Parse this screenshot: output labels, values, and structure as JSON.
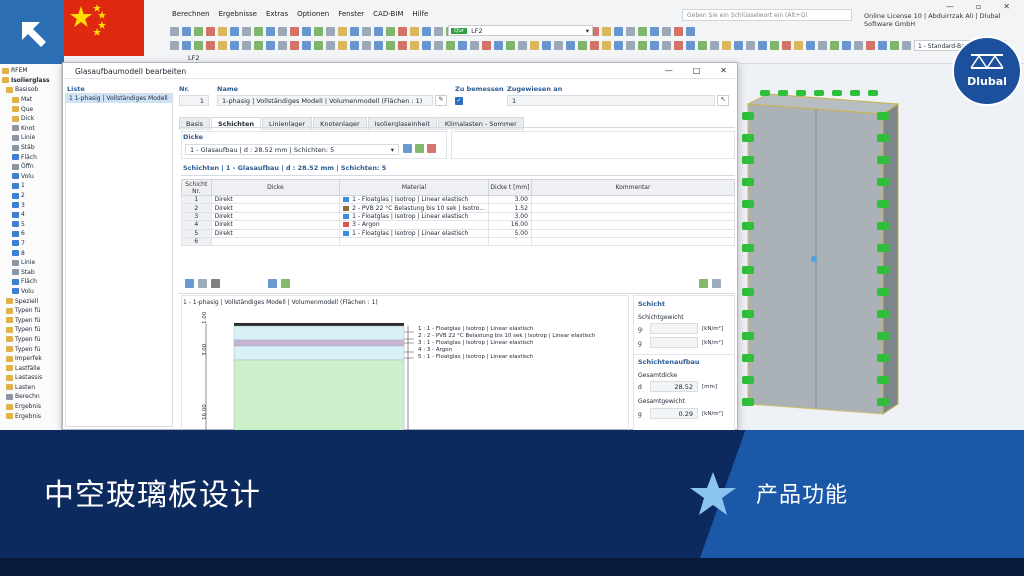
{
  "menu": {
    "items": [
      "Berechnen",
      "Ergebnisse",
      "Extras",
      "Optionen",
      "Fenster",
      "CAD-BIM",
      "Hilfe"
    ]
  },
  "search": {
    "placeholder": "Geben Sie ein Schlüsselwort ein (Alt+Q)"
  },
  "license": "Online License 10 | Abduirrzak Ali | Dlubal Software GmbH",
  "toolbar": {
    "lf_badge": "Qur",
    "lf_value": "LF2",
    "lf_label": "LF2",
    "basislayer": "1 - Standard-Basislayer"
  },
  "tree": {
    "items": [
      {
        "label": "RFEM",
        "icon": "folder"
      },
      {
        "label": "Isolierglass",
        "icon": "folder",
        "bold": true
      },
      {
        "label": "Basisob",
        "icon": "folder"
      },
      {
        "label": "Mat",
        "icon": "folder"
      },
      {
        "label": "Que",
        "icon": "folder"
      },
      {
        "label": "Dick",
        "icon": "folder"
      },
      {
        "label": "Knot",
        "icon": "grey"
      },
      {
        "label": "Linie",
        "icon": "grey"
      },
      {
        "label": "Stäb",
        "icon": "grey"
      },
      {
        "label": "Fläch",
        "icon": "blue"
      },
      {
        "label": "Öffn",
        "icon": "grey"
      },
      {
        "label": "Volu",
        "icon": "blue"
      },
      {
        "label": "1",
        "icon": "blue"
      },
      {
        "label": "2",
        "icon": "blue"
      },
      {
        "label": "3",
        "icon": "blue"
      },
      {
        "label": "4",
        "icon": "blue"
      },
      {
        "label": "5",
        "icon": "blue"
      },
      {
        "label": "6",
        "icon": "blue"
      },
      {
        "label": "7",
        "icon": "blue"
      },
      {
        "label": "8",
        "icon": "blue"
      },
      {
        "label": "Linie",
        "icon": "grey"
      },
      {
        "label": "Stab",
        "icon": "grey"
      },
      {
        "label": "Fläch",
        "icon": "blue"
      },
      {
        "label": "Volu",
        "icon": "blue"
      },
      {
        "label": "Speziell",
        "icon": "folder"
      },
      {
        "label": "Typen fü",
        "icon": "folder"
      },
      {
        "label": "Typen fü",
        "icon": "folder"
      },
      {
        "label": "Typen fü",
        "icon": "folder"
      },
      {
        "label": "Typen fü",
        "icon": "folder"
      },
      {
        "label": "Typen fü",
        "icon": "folder"
      },
      {
        "label": "Imperfek",
        "icon": "folder"
      },
      {
        "label": "Lastfälle",
        "icon": "folder"
      },
      {
        "label": "Lastassis",
        "icon": "folder"
      },
      {
        "label": "Lasten",
        "icon": "folder"
      },
      {
        "label": "Berechn",
        "icon": "grey"
      },
      {
        "label": "Ergebnis",
        "icon": "folder"
      },
      {
        "label": "Ergebnis",
        "icon": "folder"
      }
    ]
  },
  "dialog": {
    "title": "Glasaufbaumodell bearbeiten",
    "list_label": "Liste",
    "list_item": "1  1-phasig | Vollständiges Modell",
    "nr_label": "Nr.",
    "nr_value": "1",
    "name_label": "Name",
    "name_value": "1-phasig | Vollständiges Modell | Volumenmodell (Flächen : 1)",
    "zu_bemessen_label": "Zu bemessen",
    "zugewiesen_label": "Zugewiesen an",
    "zugewiesen_value": "1",
    "tabs": [
      "Basis",
      "Schichten",
      "Linienlager",
      "Knotenlager",
      "Isolierglaseinheit",
      "Klimalasten - Sommer"
    ],
    "active_tab": 1,
    "dicke_label": "Dicke",
    "dicke_value": "1 - Glasaufbau | d : 28.52 mm | Schichten: 5",
    "schichten_title": "Schichten | 1 - Glasaufbau | d : 28.52 mm | Schichten: 5",
    "table": {
      "headers": [
        "Schicht Nr.",
        "Dicke",
        "Material",
        "Dicke t [mm]",
        "Kommentar"
      ],
      "rows": [
        {
          "nr": "1",
          "dicke": "Direkt",
          "material": "1 - Floatglas | Isotrop | Linear elastisch",
          "color": "#3a8dde",
          "t": "3.00"
        },
        {
          "nr": "2",
          "dicke": "Direkt",
          "material": "2 - PVB 22 °C Belastung bis 10 sek | Isotro...",
          "color": "#8a6d3b",
          "t": "1.52"
        },
        {
          "nr": "3",
          "dicke": "Direkt",
          "material": "1 - Floatglas | Isotrop | Linear elastisch",
          "color": "#3a8dde",
          "t": "3.00"
        },
        {
          "nr": "4",
          "dicke": "Direkt",
          "material": "3 - Argon",
          "color": "#d9534f",
          "t": "16.00"
        },
        {
          "nr": "5",
          "dicke": "Direkt",
          "material": "1 - Floatglas | Isotrop | Linear elastisch",
          "color": "#3a8dde",
          "t": "5.00"
        },
        {
          "nr": "6",
          "dicke": "",
          "material": "",
          "color": "",
          "t": ""
        }
      ]
    },
    "preview_title": "1 - 1-phasig | Vollständiges Modell | Volumenmodell (Flächen : 1)",
    "legend": [
      "1 : 1 - Floatglas | Isotrop | Linear elastisch",
      "2 : 2 - PVB 22 °C Belastung bis 10 sek | Isotrop | Linear elastisch",
      "3 : 1 - Floatglas | Isotrop | Linear elastisch",
      "4 : 3 - Argon",
      "5 : 1 - Floatglas | Isotrop | Linear elastisch"
    ],
    "dim_labels": [
      "1.00",
      "3.00",
      "16.00"
    ],
    "schicht_panel": {
      "title": "Schicht",
      "gewicht_label": "Schichtgewicht",
      "g_label": "gₗ",
      "g_unit": "[kN/m²]",
      "g2_label": "g",
      "g2_unit": "[kN/m²]"
    },
    "aufbau_panel": {
      "title": "Schichtenaufbau",
      "dicke_label": "Gesamtdicke",
      "d_label": "d",
      "d_value": "28.52",
      "d_unit": "[mm]",
      "gewicht_label": "Gesamtgewicht",
      "g_label": "g",
      "g_value": "0.29",
      "g_unit": "[kN/m²]"
    }
  },
  "banner": {
    "title": "中空玻璃板设计",
    "subtitle": "产品功能"
  },
  "brand": {
    "name": "Dlubal"
  },
  "colors": {
    "accent": "#1b58a8",
    "banner": "#0d2a5f",
    "flag": "#de2910",
    "star": "#ffde00"
  }
}
